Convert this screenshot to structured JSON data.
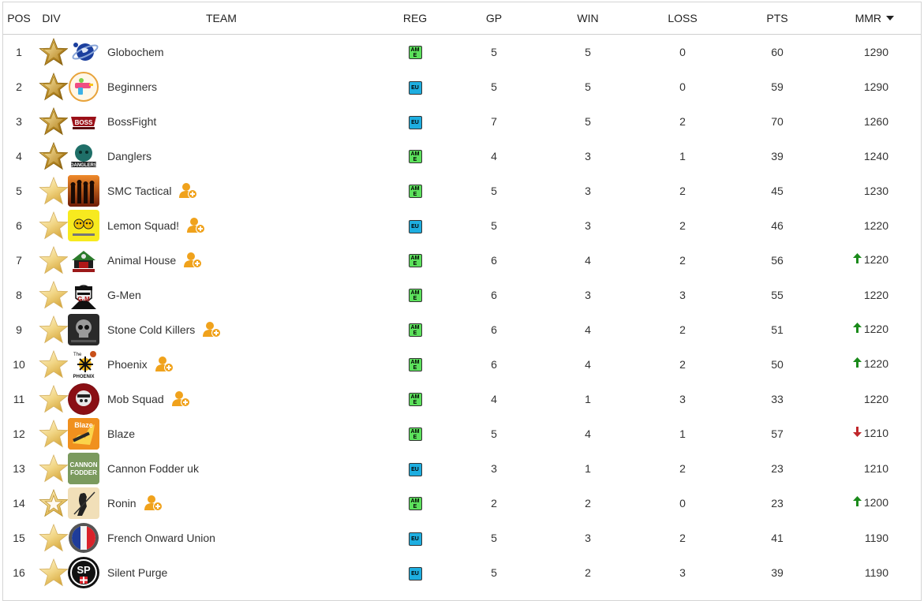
{
  "columns": {
    "pos": "POS",
    "div": "DIV",
    "team": "TEAM",
    "reg": "REG",
    "gp": "GP",
    "win": "WIN",
    "loss": "LOSS",
    "pts": "PTS",
    "mmr": "MMR"
  },
  "colors": {
    "am": "#5ce05c",
    "eu": "#1eaee0",
    "trend_up": "#1a8a1a",
    "trend_down": "#c0262a",
    "recruit": "#f0a21c"
  },
  "teams": [
    {
      "pos": "1",
      "div": "gold",
      "name": "Globochem",
      "reg": "AM",
      "gp": "5",
      "win": "5",
      "loss": "0",
      "pts": "60",
      "mmr": "1290",
      "trend": "",
      "recruiting": false,
      "logo_icon": "globe-icon"
    },
    {
      "pos": "2",
      "div": "gold",
      "name": "Beginners",
      "reg": "EU",
      "gp": "5",
      "win": "5",
      "loss": "0",
      "pts": "59",
      "mmr": "1290",
      "trend": "",
      "recruiting": false,
      "logo_icon": "water-gun-icon"
    },
    {
      "pos": "3",
      "div": "gold",
      "name": "BossFight",
      "reg": "EU",
      "gp": "7",
      "win": "5",
      "loss": "2",
      "pts": "70",
      "mmr": "1260",
      "trend": "",
      "recruiting": false,
      "logo_icon": "bossfight-logo-icon"
    },
    {
      "pos": "4",
      "div": "gold",
      "name": "Danglers",
      "reg": "AM",
      "gp": "4",
      "win": "3",
      "loss": "1",
      "pts": "39",
      "mmr": "1240",
      "trend": "",
      "recruiting": false,
      "logo_icon": "danglers-logo-icon"
    },
    {
      "pos": "5",
      "div": "light",
      "name": "SMC Tactical",
      "reg": "AM",
      "gp": "5",
      "win": "3",
      "loss": "2",
      "pts": "45",
      "mmr": "1230",
      "trend": "",
      "recruiting": true,
      "logo_icon": "soldiers-sunset-icon"
    },
    {
      "pos": "6",
      "div": "light",
      "name": "Lemon Squad!",
      "reg": "EU",
      "gp": "5",
      "win": "3",
      "loss": "2",
      "pts": "46",
      "mmr": "1220",
      "trend": "",
      "recruiting": true,
      "logo_icon": "lemon-faces-icon"
    },
    {
      "pos": "7",
      "div": "light",
      "name": "Animal House",
      "reg": "AM",
      "gp": "6",
      "win": "4",
      "loss": "2",
      "pts": "56",
      "mmr": "1220",
      "trend": "up",
      "recruiting": true,
      "logo_icon": "animal-house-logo-icon"
    },
    {
      "pos": "8",
      "div": "light",
      "name": "G-Men",
      "reg": "AM",
      "gp": "6",
      "win": "3",
      "loss": "3",
      "pts": "55",
      "mmr": "1220",
      "trend": "",
      "recruiting": false,
      "logo_icon": "gmen-face-icon"
    },
    {
      "pos": "9",
      "div": "light",
      "name": "Stone Cold Killers",
      "reg": "AM",
      "gp": "6",
      "win": "4",
      "loss": "2",
      "pts": "51",
      "mmr": "1220",
      "trend": "up",
      "recruiting": true,
      "logo_icon": "skull-icon"
    },
    {
      "pos": "10",
      "div": "light",
      "name": "Phoenix",
      "reg": "AM",
      "gp": "6",
      "win": "4",
      "loss": "2",
      "pts": "50",
      "mmr": "1220",
      "trend": "up",
      "recruiting": true,
      "logo_icon": "phoenix-logo-icon"
    },
    {
      "pos": "11",
      "div": "light",
      "name": "Mob Squad",
      "reg": "AM",
      "gp": "4",
      "win": "1",
      "loss": "3",
      "pts": "33",
      "mmr": "1220",
      "trend": "",
      "recruiting": true,
      "logo_icon": "mob-squad-logo-icon"
    },
    {
      "pos": "12",
      "div": "light",
      "name": "Blaze",
      "reg": "AM",
      "gp": "5",
      "win": "4",
      "loss": "1",
      "pts": "57",
      "mmr": "1210",
      "trend": "down",
      "recruiting": false,
      "logo_icon": "blaze-logo-icon"
    },
    {
      "pos": "13",
      "div": "light",
      "name": "Cannon Fodder uk",
      "reg": "EU",
      "gp": "3",
      "win": "1",
      "loss": "2",
      "pts": "23",
      "mmr": "1210",
      "trend": "",
      "recruiting": false,
      "logo_icon": "cannon-fodder-logo-icon"
    },
    {
      "pos": "14",
      "div": "outline",
      "name": "Ronin",
      "reg": "AM",
      "gp": "2",
      "win": "2",
      "loss": "0",
      "pts": "23",
      "mmr": "1200",
      "trend": "up",
      "recruiting": true,
      "logo_icon": "ronin-samurai-icon"
    },
    {
      "pos": "15",
      "div": "light",
      "name": "French Onward Union",
      "reg": "EU",
      "gp": "5",
      "win": "3",
      "loss": "2",
      "pts": "41",
      "mmr": "1190",
      "trend": "",
      "recruiting": false,
      "logo_icon": "french-flag-emblem-icon"
    },
    {
      "pos": "16",
      "div": "light",
      "name": "Silent Purge",
      "reg": "EU",
      "gp": "5",
      "win": "2",
      "loss": "3",
      "pts": "39",
      "mmr": "1190",
      "trend": "",
      "recruiting": false,
      "logo_icon": "sp-emblem-icon"
    }
  ]
}
